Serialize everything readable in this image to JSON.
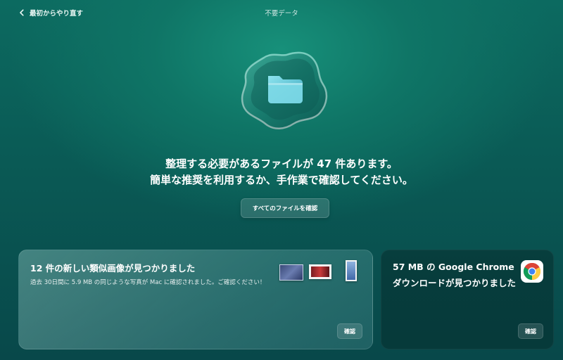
{
  "topbar": {
    "back_label": "最初からやり直す",
    "title": "不要データ"
  },
  "hero": {
    "headline_line1": "整理する必要があるファイルが 47 件あります。",
    "headline_line2": "簡単な推奨を利用するか、手作業で確認してください。",
    "review_all_label": "すべてのファイルを確認",
    "icon": "folder-icon"
  },
  "cards": {
    "similar_photos": {
      "title": "12 件の新しい類似画像が見つかりました",
      "description": "過去 30日間に 5.9 MB の同じような写真が Mac に確認されました。ご確認ください！",
      "button_label": "確認"
    },
    "chrome_downloads": {
      "title": "57 MB の Google Chrome ダウンロードが見つかりました",
      "button_label": "確認",
      "icon": "chrome-icon"
    }
  },
  "colors": {
    "background_top": "#17907a",
    "background_bottom": "#08484a",
    "folder": "#6fd0e0"
  }
}
